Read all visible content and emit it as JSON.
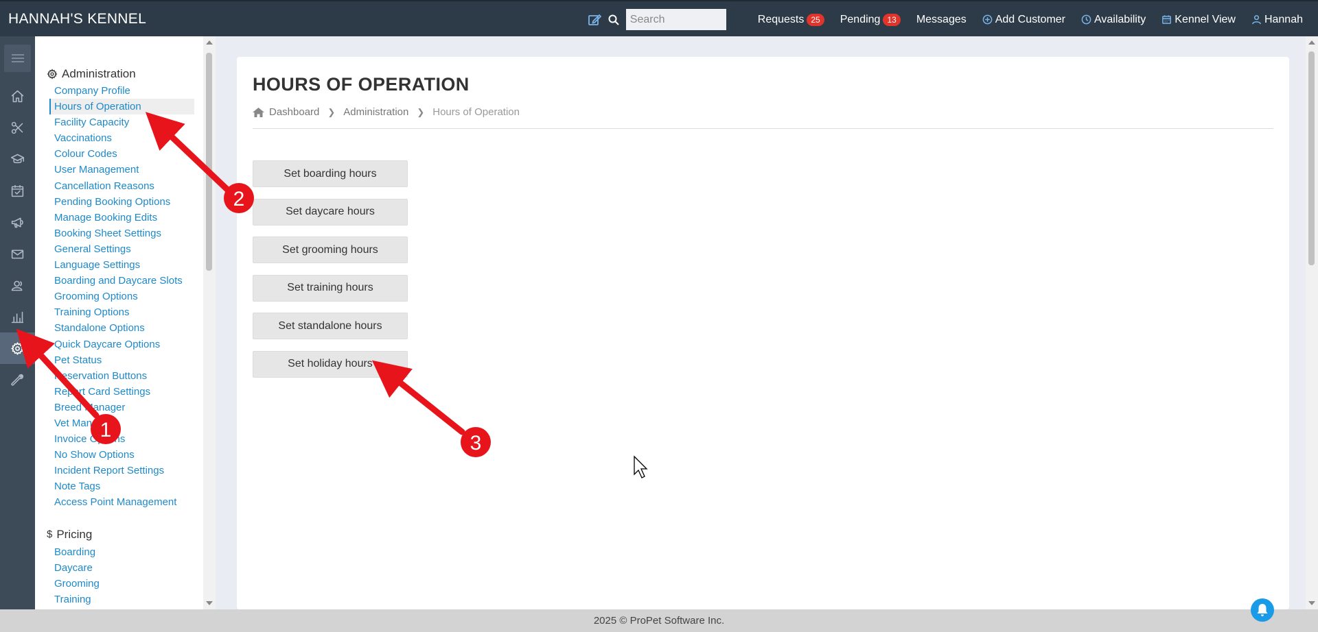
{
  "header": {
    "brand": "HANNAH'S KENNEL",
    "search_placeholder": "Search",
    "requests_label": "Requests",
    "requests_count": "25",
    "pending_label": "Pending",
    "pending_count": "13",
    "messages_label": "Messages",
    "add_customer_label": "Add Customer",
    "availability_label": "Availability",
    "kennel_view_label": "Kennel View",
    "user_name": "Hannah"
  },
  "rail": {
    "items": [
      "menu",
      "home",
      "scissors",
      "graduation-cap",
      "calendar-check",
      "megaphone",
      "mail",
      "contact",
      "bar-chart",
      "gear",
      "wrench"
    ],
    "active": "gear"
  },
  "sidebar": {
    "admin_heading": "Administration",
    "admin_items": [
      "Company Profile",
      "Hours of Operation",
      "Facility Capacity",
      "Vaccinations",
      "Colour Codes",
      "User Management",
      "Cancellation Reasons",
      "Pending Booking Options",
      "Manage Booking Edits",
      "Booking Sheet Settings",
      "General Settings",
      "Language Settings",
      "Boarding and Daycare Slots",
      "Grooming Options",
      "Training Options",
      "Standalone Options",
      "Quick Daycare Options",
      "Pet Status",
      "Reservation Buttons",
      "Report Card Settings",
      "Breed Manager",
      "Vet Manager",
      "Invoice Options",
      "No Show Options",
      "Incident Report Settings",
      "Note Tags",
      "Access Point Management"
    ],
    "active_item": "Hours of Operation",
    "pricing_heading": "Pricing",
    "pricing_items": [
      "Boarding",
      "Daycare",
      "Grooming",
      "Training"
    ]
  },
  "main": {
    "title": "HOURS OF OPERATION",
    "breadcrumb": [
      "Dashboard",
      "Administration",
      "Hours of Operation"
    ],
    "buttons": [
      "Set boarding hours",
      "Set daycare hours",
      "Set grooming hours",
      "Set training hours",
      "Set standalone hours",
      "Set holiday hours"
    ]
  },
  "annotations": {
    "steps": [
      "1",
      "2",
      "3"
    ],
    "arrow_color": "#e8141b"
  },
  "footer": {
    "text": "2025 © ProPet Software Inc."
  },
  "colors": {
    "topbar": "#2d3b48",
    "rail": "#3d4b59",
    "link": "#1e89c9",
    "badge": "#e0342c"
  }
}
